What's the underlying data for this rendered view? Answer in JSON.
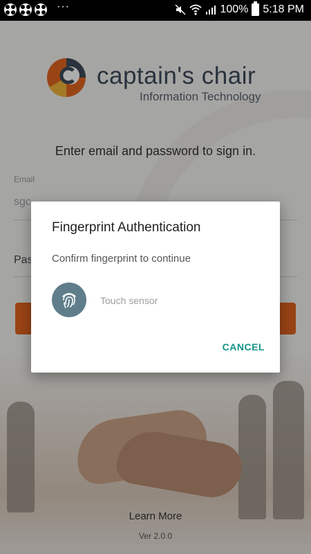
{
  "status_bar": {
    "battery": "100%",
    "time": "5:18 PM",
    "icons": [
      "app-grid-icon",
      "app-grid-icon",
      "app-grid-icon",
      "more-dots-icon",
      "mute-icon",
      "wifi-icon",
      "signal-icon",
      "battery-icon"
    ]
  },
  "login": {
    "brand_name": "captain's chair",
    "brand_subtitle": "Information Technology",
    "instruction": "Enter email and password to sign in.",
    "email_label": "Email",
    "email_value": "sgc",
    "password_placeholder": "Pas",
    "learn_more": "Learn More",
    "version": "Ver 2.0.0",
    "accent_color": "#e2651f"
  },
  "dialog": {
    "title": "Fingerprint Authentication",
    "message": "Confirm fingerprint to continue",
    "sensor_label": "Touch sensor",
    "cancel_label": "CANCEL",
    "icon": "fingerprint-icon",
    "icon_bg_color": "#607d8b",
    "button_color": "#159588"
  }
}
